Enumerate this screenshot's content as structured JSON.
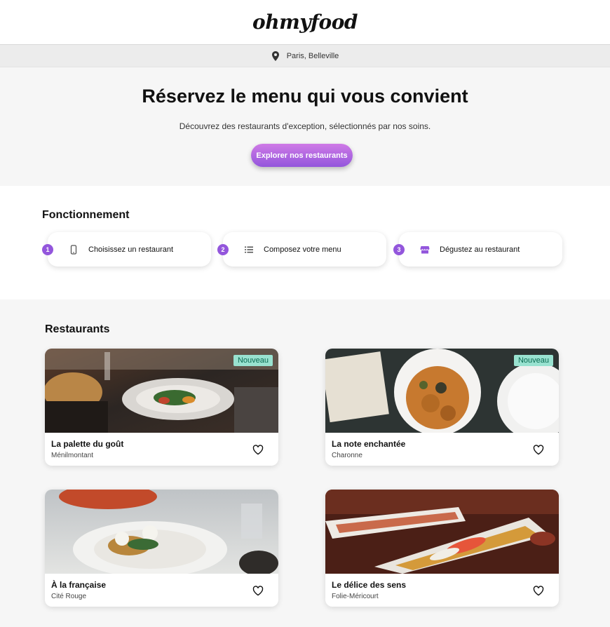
{
  "header": {
    "logo": "ohmyfood"
  },
  "location": {
    "icon": "map-pin-icon",
    "text": "Paris, Belleville"
  },
  "hero": {
    "title": "Réservez le menu qui vous convient",
    "subtitle": "Découvrez des restaurants d'exception, sélectionnés par nos soins.",
    "cta": "Explorer nos restaurants"
  },
  "how": {
    "title": "Fonctionnement",
    "steps": [
      {
        "number": "1",
        "icon": "mobile-phone-icon",
        "label": "Choisissez un restaurant"
      },
      {
        "number": "2",
        "icon": "list-icon",
        "label": "Composez votre menu"
      },
      {
        "number": "3",
        "icon": "store-icon",
        "label": "Dégustez au restaurant"
      }
    ]
  },
  "restaurants": {
    "title": "Restaurants",
    "items": [
      {
        "name": "La palette du goût",
        "area": "Ménilmontant",
        "badge": "Nouveau"
      },
      {
        "name": "La note enchantée",
        "area": "Charonne",
        "badge": "Nouveau"
      },
      {
        "name": "À la française",
        "area": "Cité Rouge"
      },
      {
        "name": "Le délice des sens",
        "area": "Folie-Méricourt"
      }
    ]
  },
  "colors": {
    "accent": "#9356dc",
    "accent_light": "#cf7ae6",
    "badge_bg": "#99e2d0",
    "badge_text": "#0b6b52"
  }
}
